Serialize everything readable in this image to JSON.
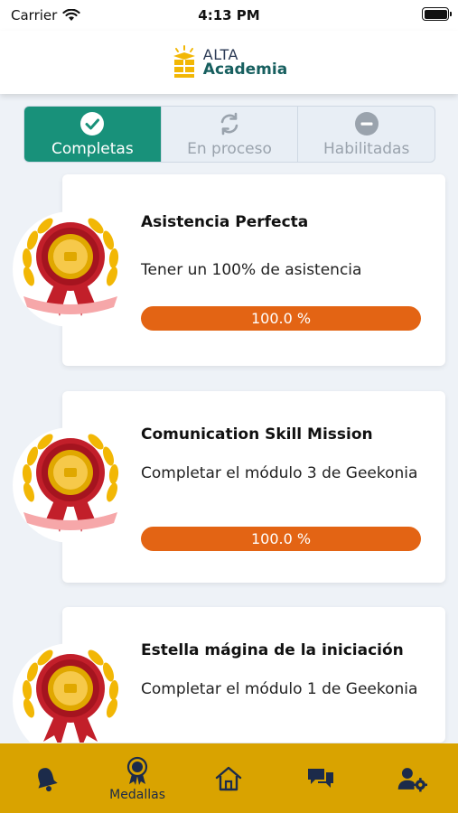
{
  "status": {
    "carrier": "Carrier",
    "time": "4:13 PM"
  },
  "brand": {
    "line1": "ALTA",
    "line2": "Academia"
  },
  "tabs": [
    {
      "label": "Completas",
      "icon": "check-circle-icon",
      "active": true
    },
    {
      "label": "En proceso",
      "icon": "refresh-icon",
      "active": false
    },
    {
      "label": "Habilitadas",
      "icon": "minus-circle-icon",
      "active": false
    }
  ],
  "medals": [
    {
      "title": "Asistencia Perfecta",
      "description": "Tener un 100% de asistencia",
      "progress": "100.0 %"
    },
    {
      "title": "Comunication Skill Mission",
      "description": "Completar el módulo 3 de Geekonia",
      "progress": "100.0 %"
    },
    {
      "title": "Estella mágina de la iniciación",
      "description": "Completar el módulo 1 de Geekonia"
    }
  ],
  "nav": [
    {
      "icon": "bell-icon",
      "label": ""
    },
    {
      "icon": "medal-icon",
      "label": "Medallas"
    },
    {
      "icon": "home-icon",
      "label": ""
    },
    {
      "icon": "chat-icon",
      "label": ""
    },
    {
      "icon": "user-settings-icon",
      "label": ""
    }
  ],
  "colors": {
    "accent": "#18917a",
    "progress": "#e36414",
    "nav": "#d9a300",
    "navIcon": "#1c2b4a"
  }
}
